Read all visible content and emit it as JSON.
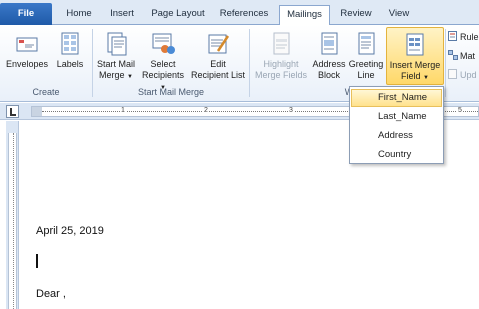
{
  "tabs": {
    "file": "File",
    "home": "Home",
    "insert": "Insert",
    "page_layout": "Page Layout",
    "references": "References",
    "mailings": "Mailings",
    "review": "Review",
    "view": "View"
  },
  "ribbon": {
    "create": {
      "label": "Create",
      "envelopes": "Envelopes",
      "labels": "Labels"
    },
    "start_mail_merge": {
      "label": "Start Mail Merge",
      "start_line1": "Start Mail",
      "start_line2": "Merge",
      "select_line1": "Select",
      "select_line2": "Recipients",
      "edit_line1": "Edit",
      "edit_line2": "Recipient List"
    },
    "write_insert": {
      "highlight_line1": "Highlight",
      "highlight_line2": "Merge Fields",
      "address_line1": "Address",
      "address_line2": "Block",
      "greeting_line1": "Greeting",
      "greeting_line2": "Line",
      "insert_line1": "Insert Merge",
      "insert_line2": "Field",
      "label_partial": "W"
    },
    "side": {
      "rules": "Rule",
      "match": "Mat",
      "update": "Upd"
    }
  },
  "ruler": {
    "n1": "1",
    "n2": "2",
    "n3": "3",
    "n5": "5"
  },
  "dropdown": {
    "items": [
      "First_Name",
      "Last_Name",
      "Address",
      "Country"
    ]
  },
  "document": {
    "date": "April 25, 2019",
    "greeting": "Dear ,"
  }
}
